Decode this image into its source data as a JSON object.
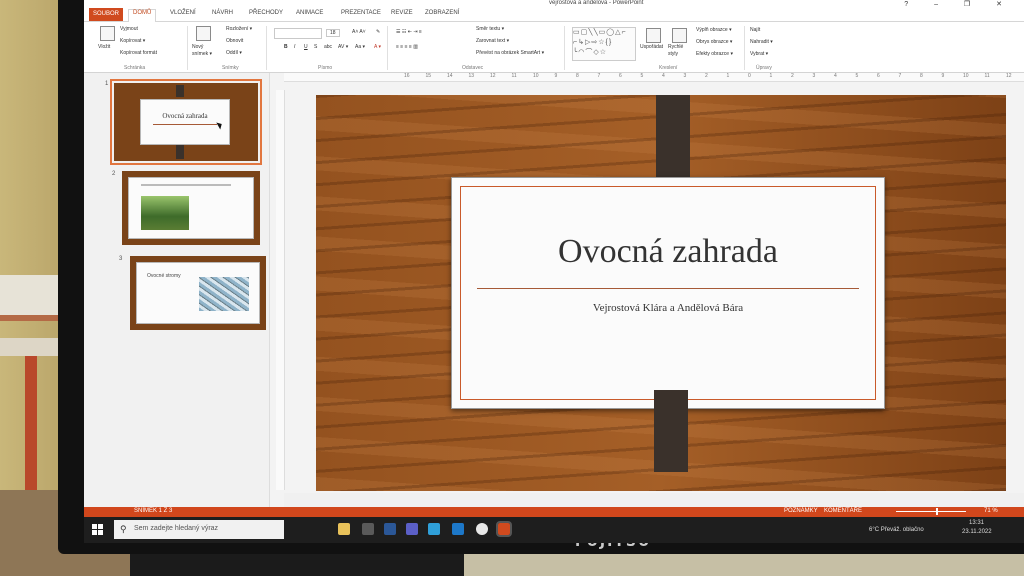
{
  "window": {
    "title": "vejrostová a andelova - PowerPoint",
    "controls": "? – ❐ ✕"
  },
  "tabs": [
    "SOUBOR",
    "DOMŮ",
    "VLOŽENÍ",
    "NÁVRH",
    "PŘECHODY",
    "ANIMACE",
    "PREZENTACE",
    "REVIZE",
    "ZOBRAZENÍ"
  ],
  "ribbon": {
    "clipboard": {
      "paste": "Vložit",
      "cut": "Vyjmout",
      "copy": "Kopírovat ▾",
      "format": "Kopírovat formát",
      "group": "Schránka"
    },
    "slides": {
      "new": "Nový snímek ▾",
      "layout": "Rozložení ▾",
      "reset": "Obnovit",
      "section": "Oddíl ▾",
      "group": "Snímky"
    },
    "font": {
      "group": "Písmo",
      "size": "18",
      "bold": "B",
      "italic": "I",
      "underline": "U",
      "strike": "S",
      "shadow": "abc",
      "spacing": "AV ▾",
      "case": "Aa ▾",
      "color": "A ▾"
    },
    "paragraph": {
      "group": "Odstavec",
      "direction": "Směr textu ▾",
      "align": "Zarovnat text ▾",
      "smartart": "Převést na obrázek SmartArt ▾"
    },
    "drawing": {
      "group": "Kreslení",
      "arrange": "Uspořádat",
      "styles": "Rychlé styly",
      "fill": "Výplň obrazce ▾",
      "outline": "Obrys obrazce ▾",
      "effects": "Efekty obrazce ▾"
    },
    "editing": {
      "group": "Úpravy",
      "find": "Najít",
      "replace": "Nahradit ▾",
      "select": "Vybrat ▾"
    }
  },
  "ruler_ticks": [
    "16",
    "15",
    "14",
    "13",
    "12",
    "11",
    "10",
    "9",
    "8",
    "7",
    "6",
    "5",
    "4",
    "3",
    "2",
    "1",
    "0",
    "1",
    "2",
    "3",
    "4",
    "5",
    "6",
    "7",
    "8",
    "9",
    "10",
    "11",
    "12",
    "13",
    "14",
    "15",
    "16"
  ],
  "thumbnails": [
    {
      "num": "1",
      "title": "Ovocná zahrada"
    },
    {
      "num": "2"
    },
    {
      "num": "3",
      "title": "Ovocné stromy"
    }
  ],
  "slide": {
    "title": "Ovocná zahrada",
    "subtitle": "Vejrostová Klára a Andělová Bára"
  },
  "statusbar": {
    "slide_info": "SNÍMEK 1 Z 3",
    "notes": "POZNÁMKY",
    "comments": "KOMENTÁŘE",
    "zoom": "71 %"
  },
  "taskbar": {
    "search_placeholder": "Sem zadejte hledaný výraz",
    "weather": "6°C  Převáž. oblačno",
    "time": "13:31",
    "date": "23.11.2022"
  },
  "monitor_brand": "FUJITSU",
  "colors": {
    "accent": "#d04a1e",
    "wood": "#8a4a1c",
    "strap": "#3a312b"
  }
}
